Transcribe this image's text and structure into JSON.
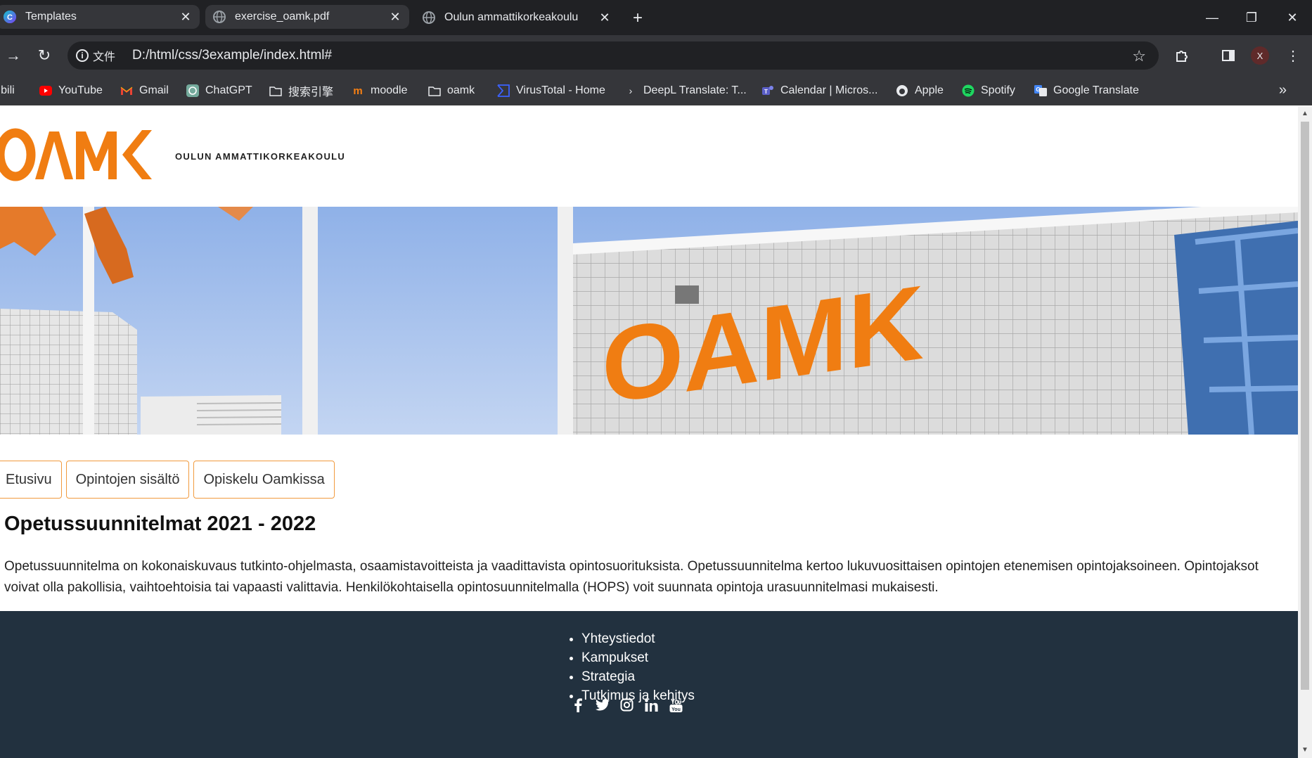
{
  "browser": {
    "tabs": [
      {
        "title": "Templates",
        "active": false
      },
      {
        "title": "exercise_oamk.pdf",
        "active": false
      },
      {
        "title": "Oulun ammattikorkeakoulu",
        "active": true
      }
    ],
    "address": {
      "scheme_label": "文件",
      "url": "D:/html/css/3example/index.html#"
    },
    "profile_initial": "X",
    "bookmarks": [
      {
        "label": "libili",
        "icon": "bilibili-icon"
      },
      {
        "label": "YouTube",
        "icon": "youtube-icon"
      },
      {
        "label": "Gmail",
        "icon": "gmail-icon"
      },
      {
        "label": "ChatGPT",
        "icon": "chatgpt-icon"
      },
      {
        "label": "搜索引擎",
        "icon": "folder-icon"
      },
      {
        "label": "moodle",
        "icon": "moodle-icon"
      },
      {
        "label": "oamk",
        "icon": "folder-icon"
      },
      {
        "label": "VirusTotal - Home",
        "icon": "virustotal-icon"
      },
      {
        "label": "DeepL Translate: T...",
        "icon": "deepl-icon"
      },
      {
        "label": "Calendar | Micros...",
        "icon": "teams-icon"
      },
      {
        "label": "Apple",
        "icon": "apple-icon"
      },
      {
        "label": "Spotify",
        "icon": "spotify-icon"
      },
      {
        "label": "Google Translate",
        "icon": "google-translate-icon"
      }
    ]
  },
  "site": {
    "logo_text": "OAMK",
    "logo_subtitle": "OULUN AMMATTIKORKEAKOULU",
    "hero_sign_text": "OAMK",
    "nav": [
      {
        "label": "Etusivu"
      },
      {
        "label": "Opintojen sisältö"
      },
      {
        "label": "Opiskelu Oamkissa"
      }
    ],
    "heading": "Opetussuunnitelmat 2021 - 2022",
    "paragraph": "Opetussuunnitelma on kokonaiskuvaus tutkinto-ohjelmasta, osaamistavoitteista ja vaadittavista opintosuorituksista. Opetussuunnitelma kertoo lukuvuosittaisen opintojen etenemisen opintojaksoineen. Opintojaksot voivat olla pakollisia, vaihtoehtoisia tai vapaasti valittavia. Henkilökohtaisella opintosuunnitelmalla (HOPS) voit suunnata opintoja urasuunnitelmasi mukaisesti.",
    "footer_links": [
      "Yhteystiedot",
      "Kampukset",
      "Strategia",
      "Tutkimus ja kehitys"
    ],
    "social_icons": [
      "facebook-icon",
      "twitter-icon",
      "instagram-icon",
      "linkedin-icon",
      "youtube-icon"
    ]
  },
  "colors": {
    "brand_orange": "#f07d12",
    "footer_bg": "#22313f",
    "nav_border": "#f19a3e",
    "chrome_dark": "#202124",
    "chrome_toolbar": "#35363a"
  }
}
